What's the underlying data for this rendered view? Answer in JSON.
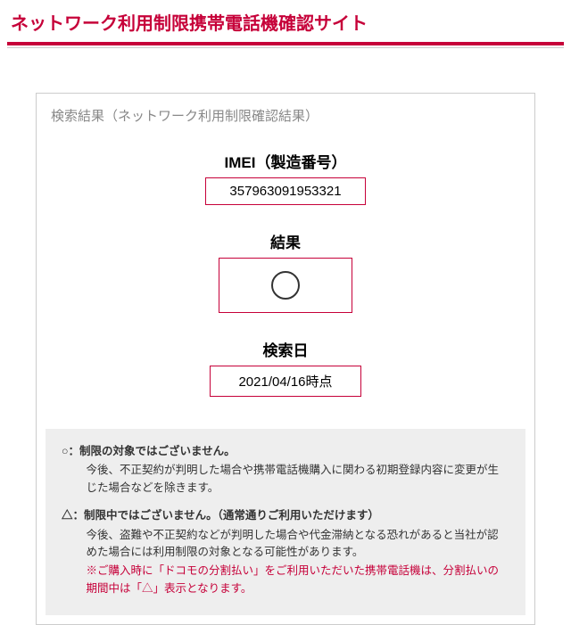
{
  "header": {
    "title": "ネットワーク利用制限携帯電話機確認サイト"
  },
  "panel": {
    "heading": "検索結果（ネットワーク利用制限確認結果）",
    "imei": {
      "label": "IMEI（製造番号）",
      "value": "357963091953321"
    },
    "result": {
      "label": "結果",
      "symbol": "circle"
    },
    "date": {
      "label": "検索日",
      "value": "2021/04/16時点"
    }
  },
  "notes": {
    "ok": {
      "title": "○：制限の対象ではございません。",
      "body": "今後、不正契約が判明した場合や携帯電話機購入に関わる初期登録内容に変更が生じた場合などを除きます。"
    },
    "tri": {
      "title": "△：制限中ではございません。（通常通りご利用いただけます）",
      "body": "今後、盗難や不正契約などが判明した場合や代金滞納となる恐れがあると当社が認めた場合には利用制限の対象となる可能性があります。",
      "caution": "※ご購入時に「ドコモの分割払い」をご利用いただいた携帯電話機は、分割払いの期間中は「△」表示となります。"
    }
  }
}
